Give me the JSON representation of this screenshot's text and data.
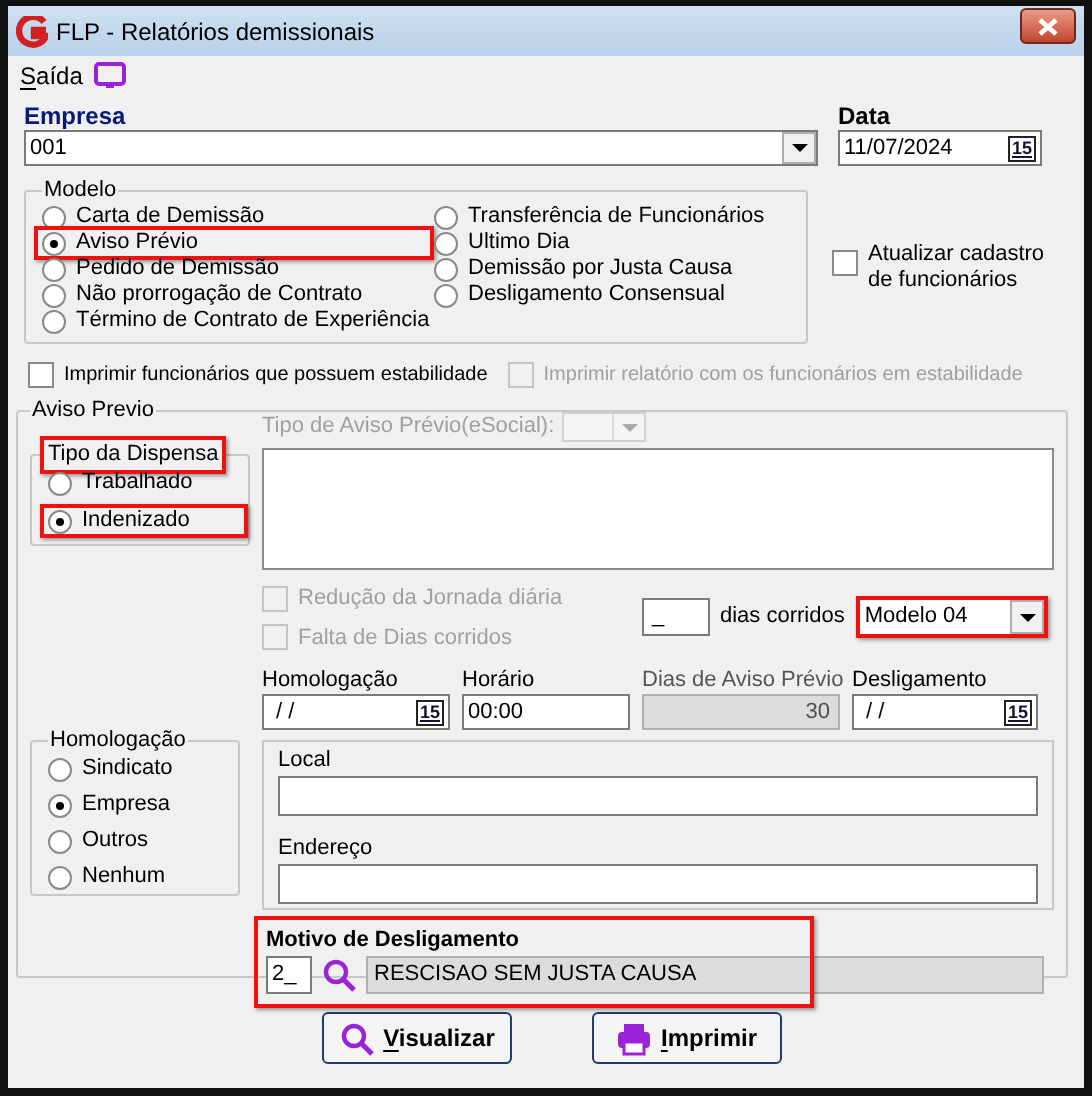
{
  "window": {
    "title": "FLP - Relatórios demissionais"
  },
  "menu": [
    {
      "label": "Saída",
      "mnemonic": true
    }
  ],
  "empresa": {
    "label": "Empresa",
    "value": "001"
  },
  "data": {
    "label": "Data",
    "value": "11/07/2024",
    "calendar_label": "15"
  },
  "modelo": {
    "title": "Modelo",
    "columns": [
      {
        "options": [
          {
            "label": "Carta de Demissão",
            "selected": false,
            "highlighted": false
          },
          {
            "label": "Aviso Prévio",
            "selected": true,
            "highlighted": true
          },
          {
            "label": "Pedido de Demissão",
            "selected": false,
            "highlighted": false
          },
          {
            "label": "Não prorrogação de Contrato",
            "selected": false,
            "highlighted": false
          },
          {
            "label": "Término de Contrato de Experiência",
            "selected": false,
            "highlighted": false
          }
        ]
      },
      {
        "options": [
          {
            "label": "Transferência de Funcionários",
            "selected": false,
            "highlighted": false
          },
          {
            "label": "Ultimo Dia",
            "selected": false,
            "highlighted": false
          },
          {
            "label": "Demissão por Justa Causa",
            "selected": false,
            "highlighted": false
          },
          {
            "label": "Desligamento Consensual",
            "selected": false,
            "highlighted": false
          }
        ]
      }
    ]
  },
  "atualizar": {
    "label": "Atualizar cadastro de funcionários",
    "checked": false
  },
  "print_options": [
    {
      "label": "Imprimir funcionários que possuem estabilidade",
      "checked": false,
      "disabled": false
    },
    {
      "label": "Imprimir relatório com os funcionários em estabilidade",
      "checked": false,
      "disabled": true
    }
  ],
  "aviso_previo": {
    "title": "Aviso Previo",
    "tipo_dispensa": {
      "title": "Tipo da Dispensa",
      "highlighted": true,
      "options": [
        {
          "label": "Trabalhado",
          "selected": false,
          "highlighted": false
        },
        {
          "label": "Indenizado",
          "selected": true,
          "highlighted": true
        }
      ]
    },
    "esocial": {
      "label": "Tipo de Aviso Prévio(eSocial):",
      "disabled": true
    },
    "checks": [
      {
        "label": "Redução da Jornada diária",
        "checked": false,
        "disabled": true
      },
      {
        "label": "Falta de Dias corridos",
        "checked": false,
        "disabled": true
      }
    ],
    "dias": {
      "value": "_",
      "label": "dias corridos"
    },
    "modelo_select": {
      "value": "Modelo 04",
      "highlighted": true
    },
    "fields": [
      {
        "kind": "date",
        "label": "Homologação",
        "value": "/ /",
        "calendar_label": "15"
      },
      {
        "kind": "text",
        "label": "Horário",
        "value": "00:00"
      },
      {
        "kind": "readonly",
        "label": "Dias de Aviso Prévio",
        "value": "30"
      },
      {
        "kind": "date",
        "label": "Desligamento",
        "value": "/ /",
        "calendar_label": "15"
      }
    ],
    "homologacao": {
      "title": "Homologação",
      "options": [
        {
          "label": "Sindicato",
          "selected": false
        },
        {
          "label": "Empresa",
          "selected": true
        },
        {
          "label": "Outros",
          "selected": false
        },
        {
          "label": "Nenhum",
          "selected": false
        }
      ]
    },
    "local": {
      "label": "Local"
    },
    "endereco": {
      "label": "Endereço"
    },
    "motivo": {
      "label": "Motivo de Desligamento",
      "code": "2_",
      "description": "RESCISAO SEM JUSTA CAUSA",
      "highlighted": true
    }
  },
  "buttons": [
    {
      "kind": "search",
      "label": "Visualizar",
      "mnemonic": true
    },
    {
      "kind": "print",
      "label": "Imprimir",
      "mnemonic": true
    }
  ]
}
